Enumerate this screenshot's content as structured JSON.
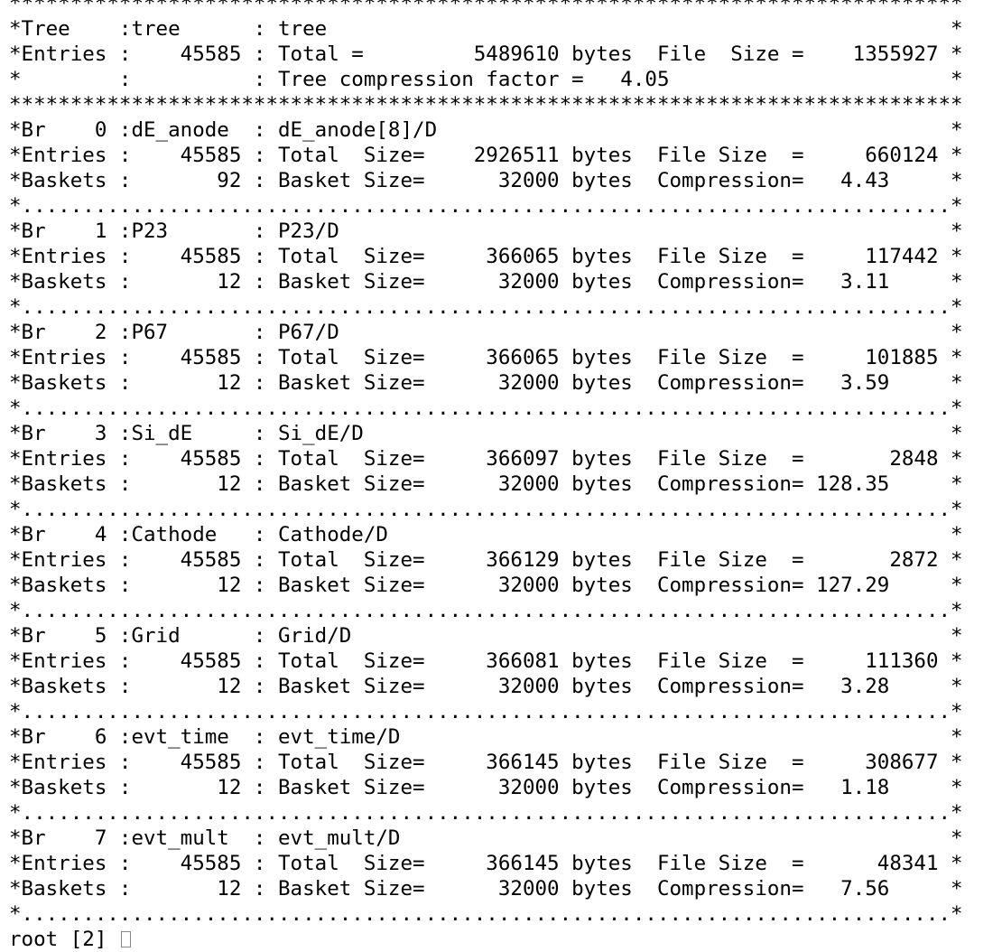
{
  "terminal": {
    "lines": [
      "******************************************************************************",
      "*Tree    :tree      : tree                                                   *",
      "*Entries :    45585 : Total =         5489610 bytes  File  Size =    1355927 *",
      "*        :          : Tree compression factor =   4.05                       *",
      "******************************************************************************",
      "*Br    0 :dE_anode  : dE_anode[8]/D                                          *",
      "*Entries :    45585 : Total  Size=    2926511 bytes  File Size  =     660124 *",
      "*Baskets :       92 : Basket Size=      32000 bytes  Compression=   4.43     *",
      "*............................................................................*",
      "*Br    1 :P23       : P23/D                                                  *",
      "*Entries :    45585 : Total  Size=     366065 bytes  File Size  =     117442 *",
      "*Baskets :       12 : Basket Size=      32000 bytes  Compression=   3.11     *",
      "*............................................................................*",
      "*Br    2 :P67       : P67/D                                                  *",
      "*Entries :    45585 : Total  Size=     366065 bytes  File Size  =     101885 *",
      "*Baskets :       12 : Basket Size=      32000 bytes  Compression=   3.59     *",
      "*............................................................................*",
      "*Br    3 :Si_dE     : Si_dE/D                                                *",
      "*Entries :    45585 : Total  Size=     366097 bytes  File Size  =       2848 *",
      "*Baskets :       12 : Basket Size=      32000 bytes  Compression= 128.35     *",
      "*............................................................................*",
      "*Br    4 :Cathode   : Cathode/D                                              *",
      "*Entries :    45585 : Total  Size=     366129 bytes  File Size  =       2872 *",
      "*Baskets :       12 : Basket Size=      32000 bytes  Compression= 127.29     *",
      "*............................................................................*",
      "*Br    5 :Grid      : Grid/D                                                 *",
      "*Entries :    45585 : Total  Size=     366081 bytes  File Size  =     111360 *",
      "*Baskets :       12 : Basket Size=      32000 bytes  Compression=   3.28     *",
      "*............................................................................*",
      "*Br    6 :evt_time  : evt_time/D                                             *",
      "*Entries :    45585 : Total  Size=     366145 bytes  File Size  =     308677 *",
      "*Baskets :       12 : Basket Size=      32000 bytes  Compression=   1.18     *",
      "*............................................................................*",
      "*Br    7 :evt_mult  : evt_mult/D                                             *",
      "*Entries :    45585 : Total  Size=     366145 bytes  File Size  =      48341 *",
      "*Baskets :       12 : Basket Size=      32000 bytes  Compression=   7.56     *",
      "*............................................................................*"
    ],
    "prompt_text": "root [2] "
  }
}
